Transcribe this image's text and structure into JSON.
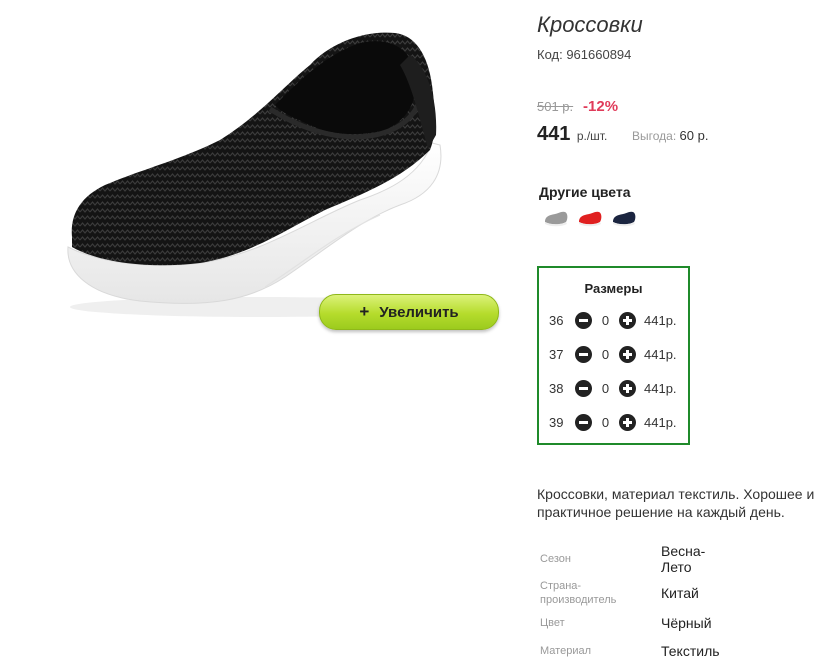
{
  "product": {
    "title": "Кроссовки",
    "code": "Код: 961660894",
    "zoom_label": "Увеличить",
    "zoom_icon": "plus-icon"
  },
  "price": {
    "old": "501 р.",
    "discount": "-12%",
    "current": "441",
    "unit": "р./шт.",
    "benefit_label": "Выгода:",
    "benefit_value": "60 р."
  },
  "colors": {
    "title": "Другие цвета",
    "swatches": [
      {
        "name": "gray",
        "hex": "#9a9a9a"
      },
      {
        "name": "red",
        "hex": "#e02020"
      },
      {
        "name": "navy",
        "hex": "#1b2540"
      }
    ]
  },
  "sizes": {
    "title": "Размеры",
    "rows": [
      {
        "size": "36",
        "qty": "0",
        "price": "441р."
      },
      {
        "size": "37",
        "qty": "0",
        "price": "441р."
      },
      {
        "size": "38",
        "qty": "0",
        "price": "441р."
      },
      {
        "size": "39",
        "qty": "0",
        "price": "441р."
      }
    ]
  },
  "description": "Кроссовки, материал текстиль. Хорошее и практичное решение на каждый день.",
  "specs": [
    {
      "label": "Сезон",
      "value": "Весна-Лето"
    },
    {
      "label": "Страна-производитель",
      "value": "Китай"
    },
    {
      "label": "Цвет",
      "value": "Чёрный"
    },
    {
      "label": "Материал",
      "value": "Текстиль"
    }
  ],
  "colors_theme": {
    "accent_green": "#1f8a2a",
    "discount_red": "#e03b5a",
    "button_green": "#b5dc2c"
  }
}
